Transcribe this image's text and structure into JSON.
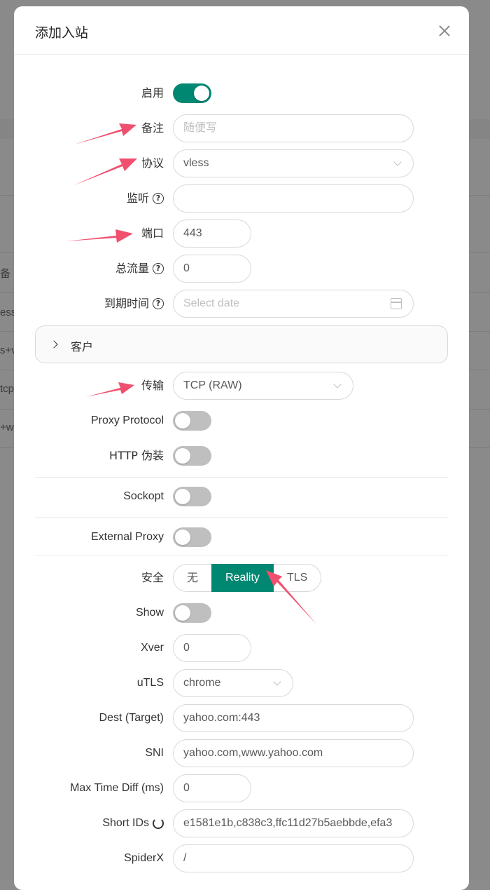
{
  "dialog": {
    "title": "添加入站"
  },
  "background_rows": [
    "备",
    "ess",
    "s+v",
    "tcp",
    "+w"
  ],
  "form": {
    "enable_label": "启用",
    "remark_label": "备注",
    "remark_placeholder": "随便写",
    "protocol_label": "协议",
    "protocol_value": "vless",
    "listen_label": "监听",
    "listen_value": "",
    "port_label": "端口",
    "port_value": "443",
    "total_traffic_label": "总流量",
    "total_traffic_value": "0",
    "expiry_label": "到期时间",
    "expiry_placeholder": "Select date",
    "clients_label": "客户",
    "transport_label": "传输",
    "transport_value": "TCP (RAW)",
    "proxy_protocol_label": "Proxy Protocol",
    "http_obfs_label": "HTTP 伪装",
    "sockopt_label": "Sockopt",
    "external_proxy_label": "External Proxy",
    "security_label": "安全",
    "security_options": [
      "无",
      "Reality",
      "TLS"
    ],
    "security_selected": "Reality",
    "show_label": "Show",
    "xver_label": "Xver",
    "xver_value": "0",
    "utls_label": "uTLS",
    "utls_value": "chrome",
    "dest_label": "Dest (Target)",
    "dest_value": "yahoo.com:443",
    "sni_label": "SNI",
    "sni_value": "yahoo.com,www.yahoo.com",
    "max_time_diff_label": "Max Time Diff (ms)",
    "max_time_diff_value": "0",
    "short_ids_label": "Short IDs",
    "short_ids_value": "e1581e1b,c838c3,ffc11d27b5aebbde,efa3",
    "spiderx_label": "SpiderX",
    "spiderx_value": "/"
  },
  "toggles": {
    "enable": true,
    "proxy_protocol": false,
    "http_obfs": false,
    "sockopt": false,
    "external_proxy": false,
    "show": false
  },
  "colors": {
    "accent": "#008771",
    "annotation_arrow": "#f0506e"
  }
}
